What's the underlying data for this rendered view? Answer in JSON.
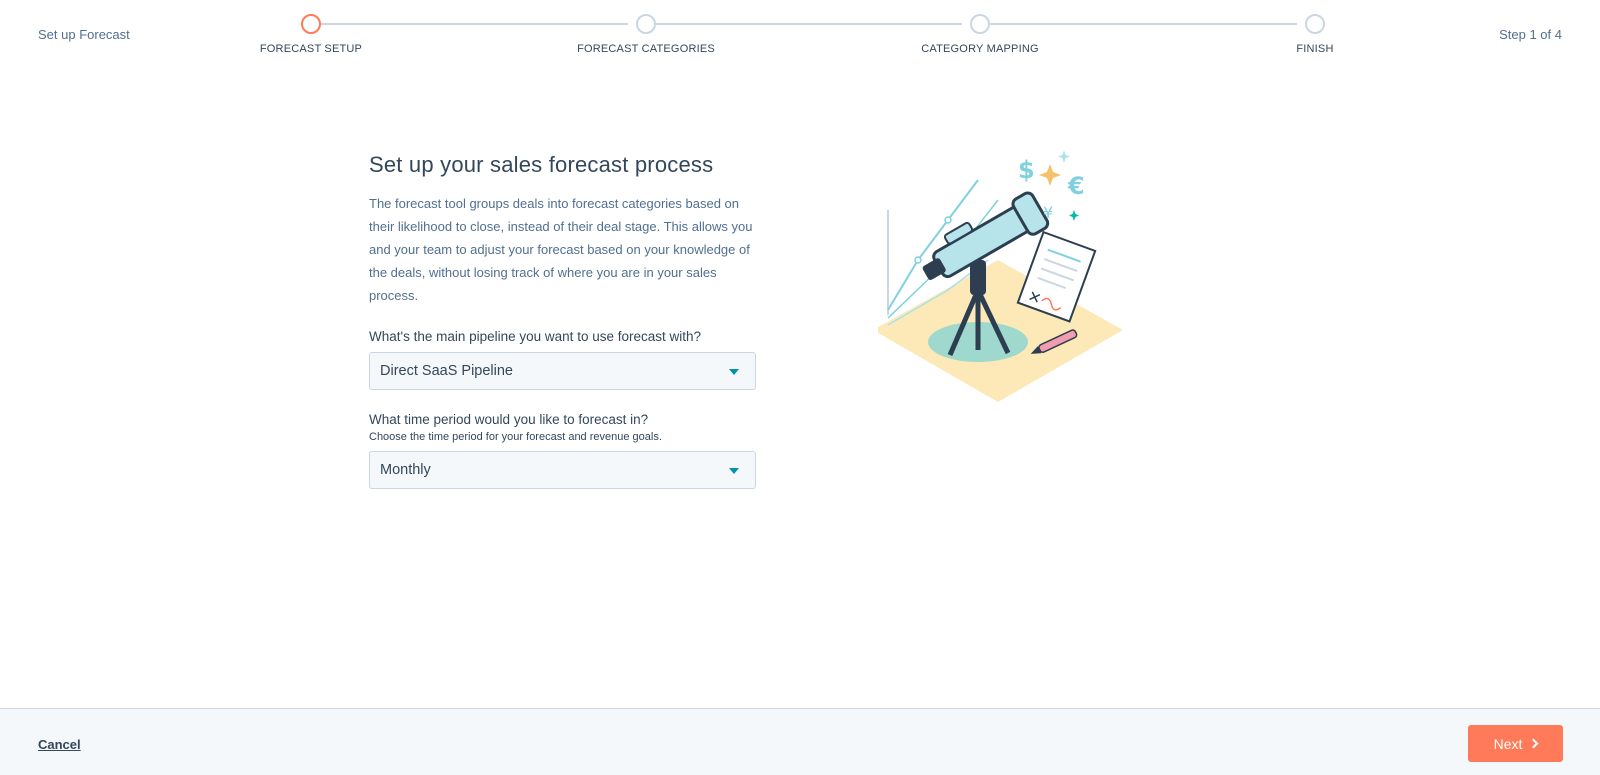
{
  "header": {
    "title": "Set up Forecast",
    "step_counter": "Step 1 of 4",
    "steps": [
      {
        "label": "FORECAST SETUP",
        "active": true
      },
      {
        "label": "FORECAST CATEGORIES",
        "active": false
      },
      {
        "label": "CATEGORY MAPPING",
        "active": false
      },
      {
        "label": "FINISH",
        "active": false
      }
    ]
  },
  "main": {
    "heading": "Set up your sales forecast process",
    "intro": "The forecast tool groups deals into forecast categories based on their likelihood to close, instead of their deal stage. This allows you and your team to adjust your forecast based on your knowledge of the deals, without losing track of where you are in your sales process.",
    "pipeline": {
      "label": "What's the main pipeline you want to use forecast with?",
      "value": "Direct SaaS Pipeline"
    },
    "period": {
      "label": "What time period would you like to forecast in?",
      "help": "Choose the time period for your forecast and revenue goals.",
      "value": "Monthly"
    }
  },
  "illustration": {
    "icon": "telescope-illustration",
    "currency_symbols": [
      "$",
      "€",
      "¥"
    ]
  },
  "footer": {
    "cancel_label": "Cancel",
    "next_label": "Next"
  },
  "colors": {
    "accent": "#ff7a59",
    "text": "#33475b",
    "muted": "#516f90",
    "border": "#cbd6e2",
    "caret": "#0091ae",
    "teal": "#7fd1de"
  }
}
